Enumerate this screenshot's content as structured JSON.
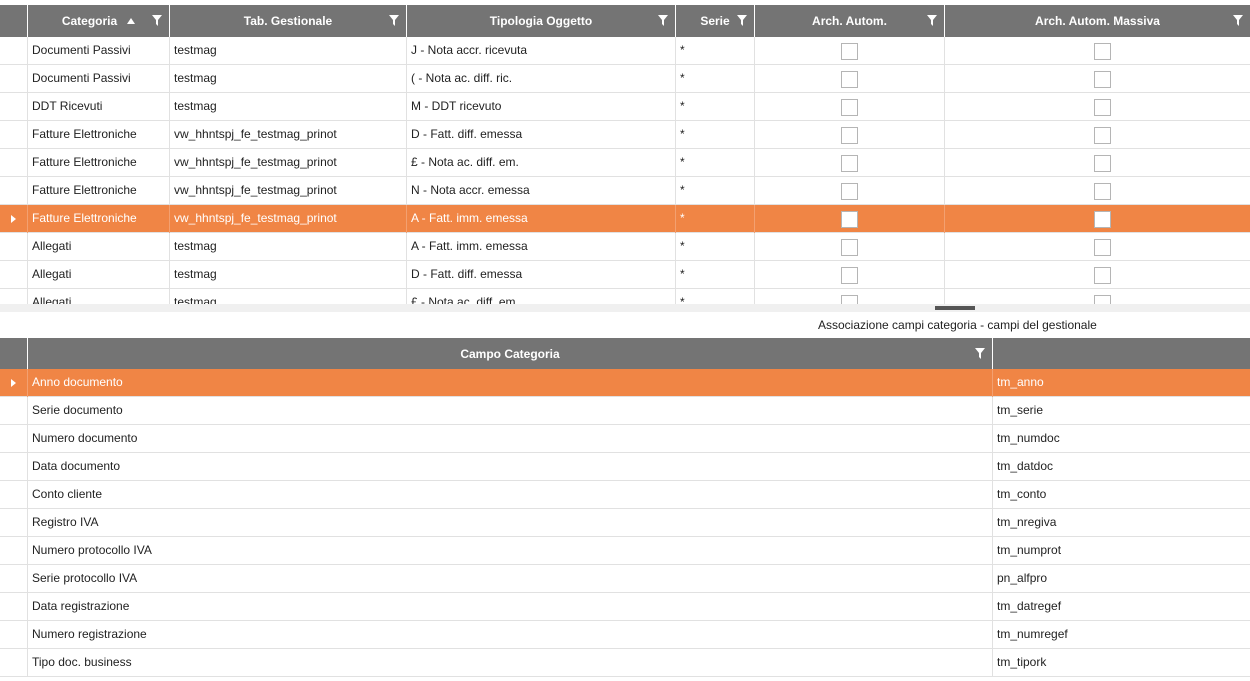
{
  "top_grid": {
    "columns": [
      "Categoria",
      "Tab. Gestionale",
      "Tipologia Oggetto",
      "Serie",
      "Arch. Autom.",
      "Arch. Autom. Massiva"
    ],
    "rows": [
      {
        "categoria": "Documenti Passivi",
        "tab": "testmag",
        "tipologia": "J - Nota accr. ricevuta",
        "serie": "*",
        "selected": false
      },
      {
        "categoria": "Documenti Passivi",
        "tab": "testmag",
        "tipologia": "( - Nota ac. diff. ric.",
        "serie": "*",
        "selected": false
      },
      {
        "categoria": "DDT Ricevuti",
        "tab": "testmag",
        "tipologia": "M - DDT ricevuto",
        "serie": "*",
        "selected": false
      },
      {
        "categoria": "Fatture Elettroniche",
        "tab": "vw_hhntspj_fe_testmag_prinot",
        "tipologia": "D - Fatt. diff. emessa",
        "serie": "*",
        "selected": false
      },
      {
        "categoria": "Fatture Elettroniche",
        "tab": "vw_hhntspj_fe_testmag_prinot",
        "tipologia": "£ - Nota ac. diff. em.",
        "serie": "*",
        "selected": false
      },
      {
        "categoria": "Fatture Elettroniche",
        "tab": "vw_hhntspj_fe_testmag_prinot",
        "tipologia": "N - Nota accr. emessa",
        "serie": "*",
        "selected": false
      },
      {
        "categoria": "Fatture Elettroniche",
        "tab": "vw_hhntspj_fe_testmag_prinot",
        "tipologia": "A - Fatt. imm. emessa",
        "serie": "*",
        "selected": true
      },
      {
        "categoria": "Allegati",
        "tab": "testmag",
        "tipologia": "A - Fatt. imm. emessa",
        "serie": "*",
        "selected": false
      },
      {
        "categoria": "Allegati",
        "tab": "testmag",
        "tipologia": "D - Fatt. diff. emessa",
        "serie": "*",
        "selected": false
      },
      {
        "categoria": "Allegati",
        "tab": "testmag",
        "tipologia": "£ - Nota ac. diff. em.",
        "serie": "*",
        "selected": false
      }
    ]
  },
  "section_title": "Associazione campi categoria - campi del gestionale",
  "bottom_grid": {
    "columns": [
      "Campo Categoria",
      ""
    ],
    "rows": [
      {
        "campo": "Anno documento",
        "gestionale": "tm_anno",
        "selected": true
      },
      {
        "campo": "Serie documento",
        "gestionale": "tm_serie",
        "selected": false
      },
      {
        "campo": "Numero documento",
        "gestionale": "tm_numdoc",
        "selected": false
      },
      {
        "campo": "Data documento",
        "gestionale": "tm_datdoc",
        "selected": false
      },
      {
        "campo": "Conto cliente",
        "gestionale": "tm_conto",
        "selected": false
      },
      {
        "campo": "Registro IVA",
        "gestionale": "tm_nregiva",
        "selected": false
      },
      {
        "campo": "Numero protocollo IVA",
        "gestionale": "tm_numprot",
        "selected": false
      },
      {
        "campo": "Serie protocollo IVA",
        "gestionale": "pn_alfpro",
        "selected": false
      },
      {
        "campo": "Data registrazione",
        "gestionale": "tm_datregef",
        "selected": false
      },
      {
        "campo": "Numero registrazione",
        "gestionale": "tm_numregef",
        "selected": false
      },
      {
        "campo": "Tipo doc. business",
        "gestionale": "tm_tipork",
        "selected": false
      }
    ]
  },
  "colors": {
    "header_bg": "#747474",
    "selection": "#f08545",
    "grid_line": "#e1e1e1"
  }
}
